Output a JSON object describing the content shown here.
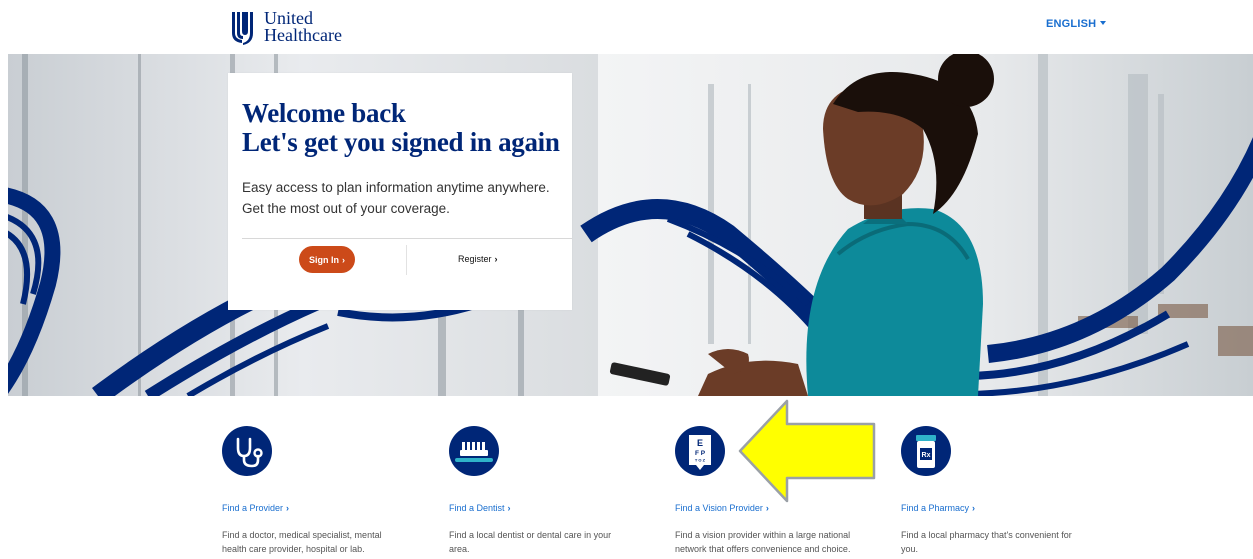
{
  "header": {
    "logo_line1": "United",
    "logo_line2": "Healthcare",
    "language": "ENGLISH"
  },
  "hero": {
    "title_line1": "Welcome back",
    "title_line2": "Let's get you signed in again",
    "subtitle_line1": "Easy access to plan information anytime anywhere.",
    "subtitle_line2": "Get the most out of your coverage.",
    "signin_label": "Sign In",
    "register_label": "Register"
  },
  "features": [
    {
      "icon": "stethoscope-icon",
      "link": "Find a Provider",
      "desc_line1": "Find a doctor, medical specialist, mental",
      "desc_line2": "health care provider, hospital or lab."
    },
    {
      "icon": "toothbrush-icon",
      "link": "Find a Dentist",
      "desc_line1": "Find a local dentist or dental care in your",
      "desc_line2": "area."
    },
    {
      "icon": "eye-chart-icon",
      "link": "Find a Vision Provider",
      "desc_line1": "Find a vision provider within a large national",
      "desc_line2": "network that offers convenience and choice."
    },
    {
      "icon": "pharmacy-bottle-icon",
      "link": "Find a Pharmacy",
      "desc_line1": "Find a local pharmacy that's convenient for",
      "desc_line2": "you."
    }
  ],
  "eye_chart": {
    "row1": "E",
    "row2": "F P",
    "row3": "T O Z"
  },
  "rx_label": "Rx",
  "colors": {
    "brand_blue": "#002677",
    "link_blue": "#196ecf",
    "signin_orange": "#cc4a19",
    "annotation_yellow": "#ffff00"
  }
}
